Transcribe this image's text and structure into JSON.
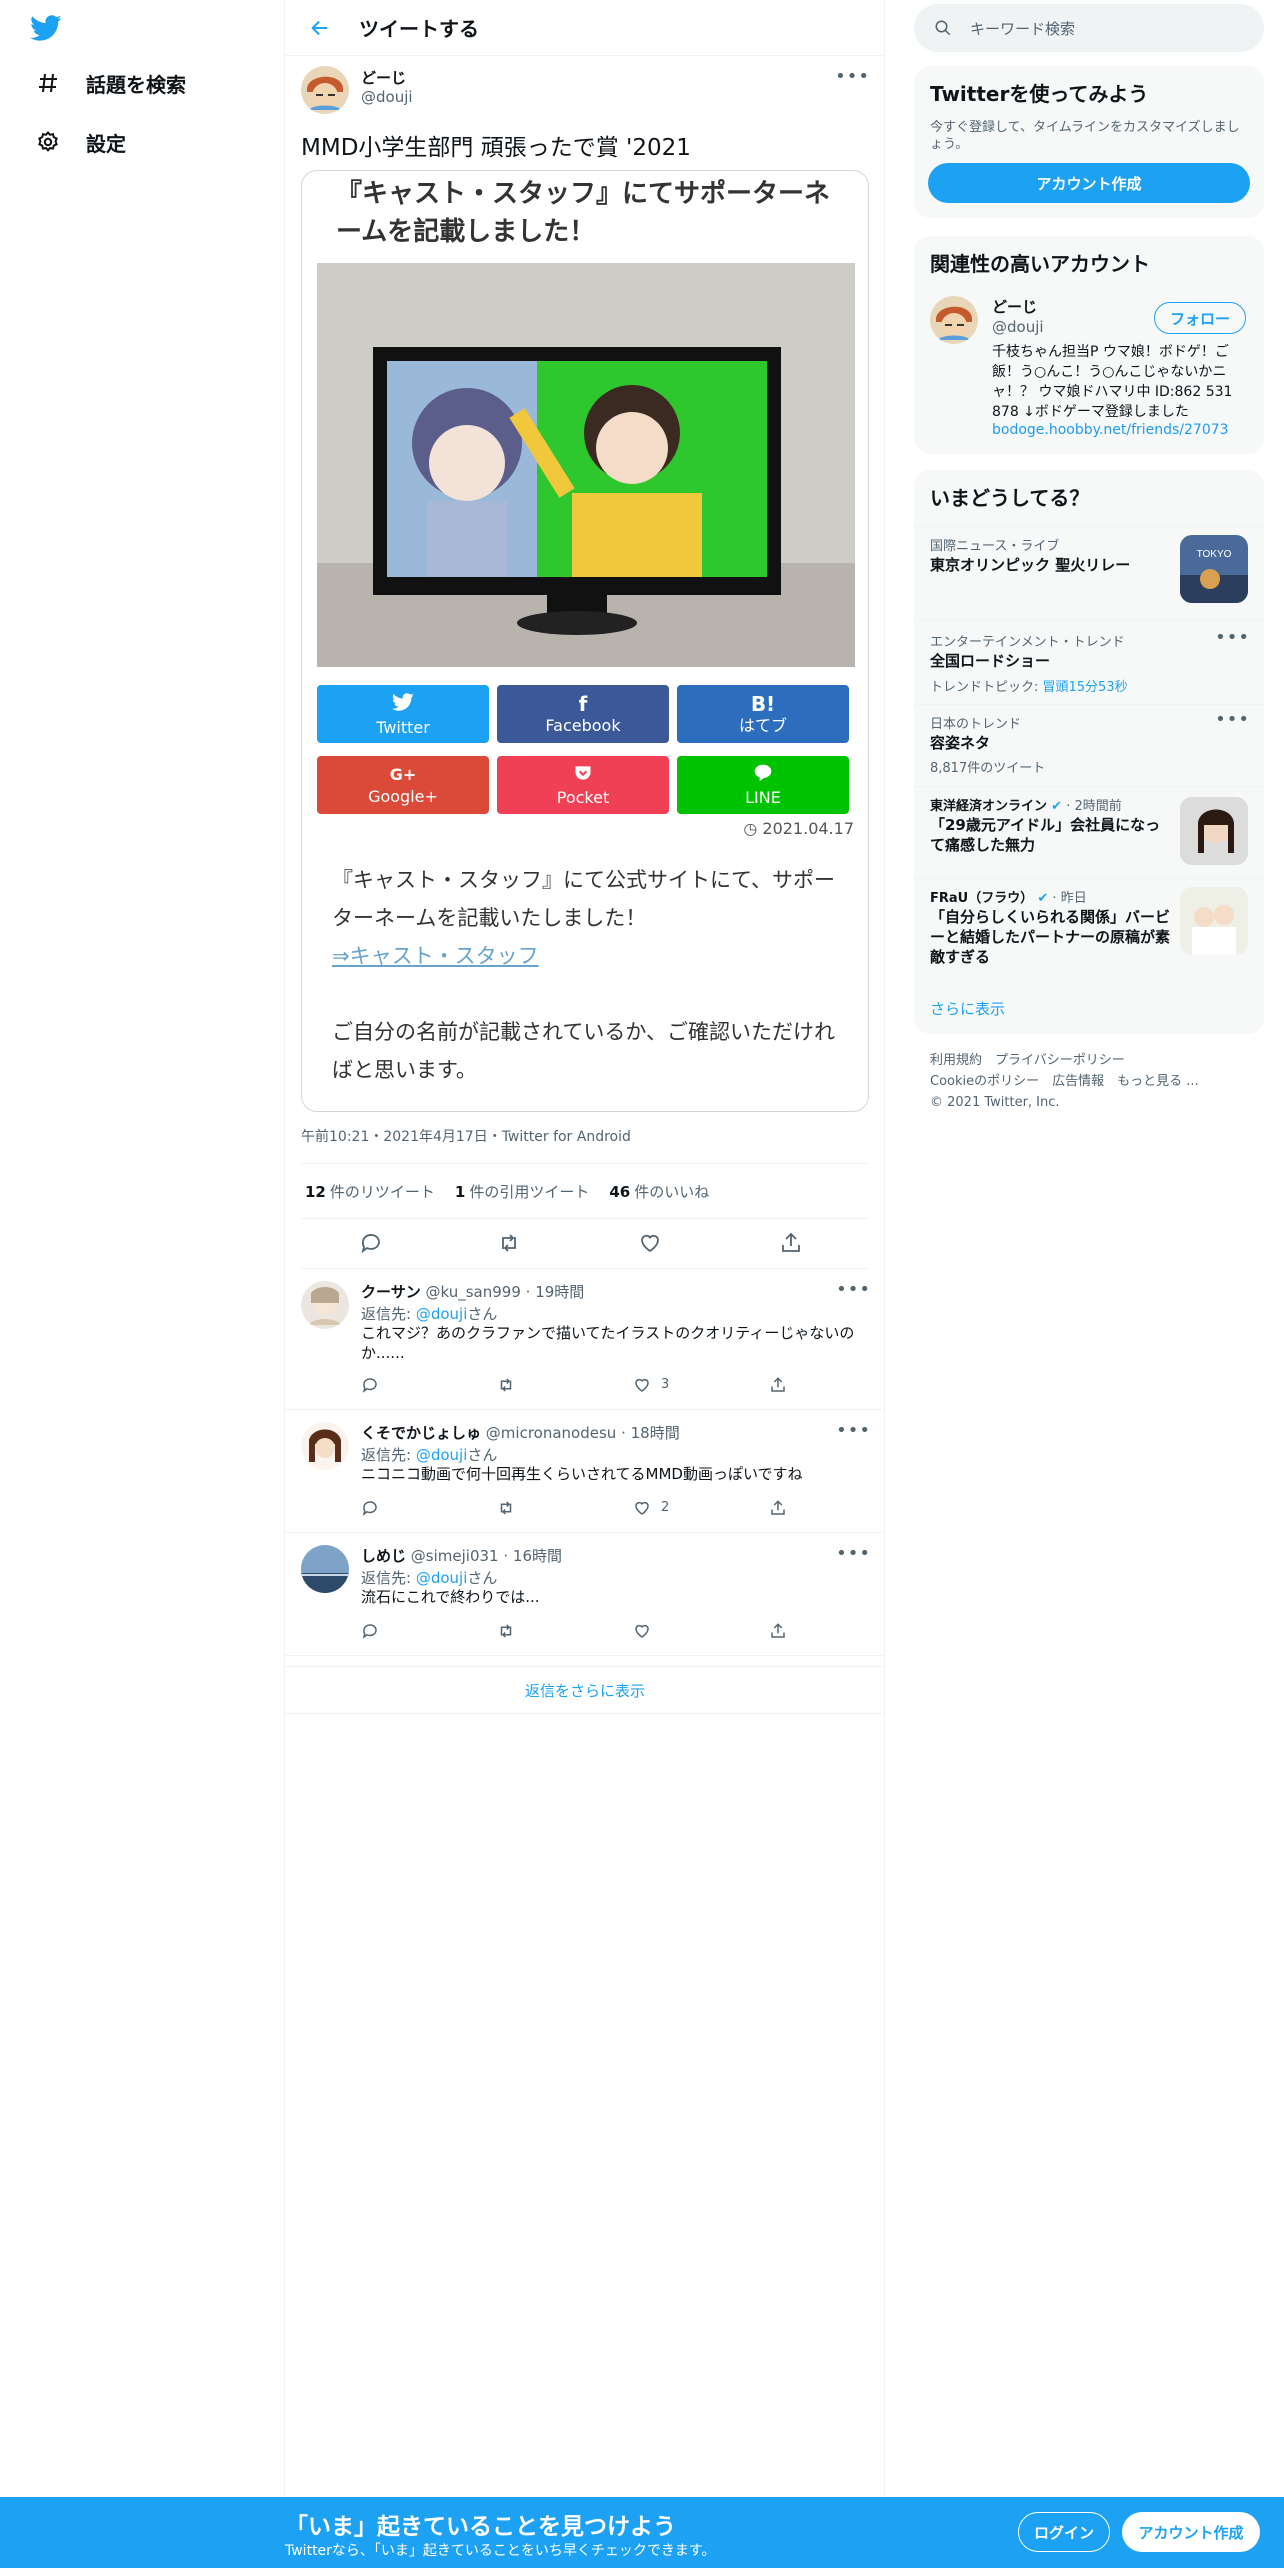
{
  "nav": {
    "explore_label": "話題を検索",
    "settings_label": "設定"
  },
  "header": {
    "title": "ツイートする"
  },
  "tweet": {
    "author_name": "どーじ",
    "author_handle": "@douji",
    "text": "MMD小学生部門 頑張ったで賞 '2021",
    "card": {
      "title": "『キャスト・スタッフ』にてサポーターネームを記載しました！",
      "share_buttons": [
        {
          "label": "Twitter",
          "color": "#1da1f2"
        },
        {
          "label": "Facebook",
          "color": "#3b5998"
        },
        {
          "label": "はてブ",
          "symbol": "B!",
          "color": "#2c6ebd"
        },
        {
          "label": "Google+",
          "symbol": "G+",
          "color": "#db4a39"
        },
        {
          "label": "Pocket",
          "color": "#ef4056"
        },
        {
          "label": "LINE",
          "color": "#00c300"
        }
      ],
      "date": "2021.04.17",
      "body_text": "『キャスト・スタッフ』にて公式サイトにて、サポーターネームを記載いたしました！",
      "link_text": "⇒キャスト・スタッフ",
      "body_text2": "ご自分の名前が記載されているか、ご確認いただければと思います。"
    },
    "meta": "午前10:21・2021年4月17日・Twitter for Android",
    "retweets": "12",
    "retweets_label": "件のリツイート",
    "quotes": "1",
    "quotes_label": "件の引用ツイート",
    "likes": "46",
    "likes_label": "件のいいね"
  },
  "replies": [
    {
      "name": "クーサン",
      "handle": "@ku_san999",
      "time": "19時間",
      "reply_to_prefix": "返信先: ",
      "reply_to": "@douji",
      "reply_to_suffix": "さん",
      "text": "これマジ？あのクラファンで描いてたイラストのクオリティーじゃないのか......",
      "likes": "3"
    },
    {
      "name": "くそでかじょしゅ",
      "handle": "@micronanodesu",
      "time": "18時間",
      "reply_to_prefix": "返信先: ",
      "reply_to": "@douji",
      "reply_to_suffix": "さん",
      "text": "ニコニコ動画で何十回再生くらいされてるMMD動画っぽいですね",
      "likes": "2"
    },
    {
      "name": "しめじ",
      "handle": "@simeji031",
      "time": "16時間",
      "reply_to_prefix": "返信先: ",
      "reply_to": "@douji",
      "reply_to_suffix": "さん",
      "text": "流石にこれで終わりでは...",
      "likes": ""
    }
  ],
  "show_more_replies": "返信をさらに表示",
  "search": {
    "placeholder": "キーワード検索"
  },
  "signup": {
    "title": "Twitterを使ってみよう",
    "subtitle": "今すぐ登録して、タイムラインをカスタマイズしましょう。",
    "button": "アカウント作成"
  },
  "related": {
    "title": "関連性の高いアカウント",
    "name": "どーじ",
    "handle": "@douji",
    "follow": "フォロー",
    "bio": "千枝ちゃん担当P ウマ娘！ボドゲ！ご飯！う○んこ！う○んこじゃないかニャ！？ ウマ娘ドハマリ中 ID:862 531 878 ↓ボドゲーマ登録しました",
    "link": "bodoge.hoobby.net/friends/27073"
  },
  "trends": {
    "title": "いまどうしてる？",
    "items": [
      {
        "category": "国際ニュース・ライブ",
        "title": "東京オリンピック 聖火リレー",
        "sub": ""
      },
      {
        "category": "エンターテインメント・トレンド",
        "title": "全国ロードショー",
        "sub": "トレンドトピック: ",
        "sub_link": "冒頭15分53秒"
      },
      {
        "category": "日本のトレンド",
        "title": "容姿ネタ",
        "sub": "8,817件のツイート"
      }
    ],
    "news": [
      {
        "source": "東洋経済オンライン",
        "time": "2時間前",
        "title": "「29歳元アイドル」会社員になって痛感した無力"
      },
      {
        "source": "FRaU（フラウ）",
        "time": "昨日",
        "title": "「自分らしくいられる関係」バービーと結婚したパートナーの原稿が素敵すぎる"
      }
    ],
    "show_more": "さらに表示"
  },
  "footer": {
    "line1": "利用規約　プライバシーポリシー",
    "line2": "Cookieのポリシー　広告情報　もっと見る ...",
    "line3": "© 2021 Twitter, Inc."
  },
  "bottom": {
    "title": "「いま」起きていることを見つけよう",
    "subtitle": "Twitterなら、「いま」起きていることをいち早くチェックできます。",
    "login": "ログイン",
    "signup": "アカウント作成"
  },
  "colors": {
    "accent": "#1da1f2",
    "text": "#0f1419",
    "secondary": "#536471"
  }
}
